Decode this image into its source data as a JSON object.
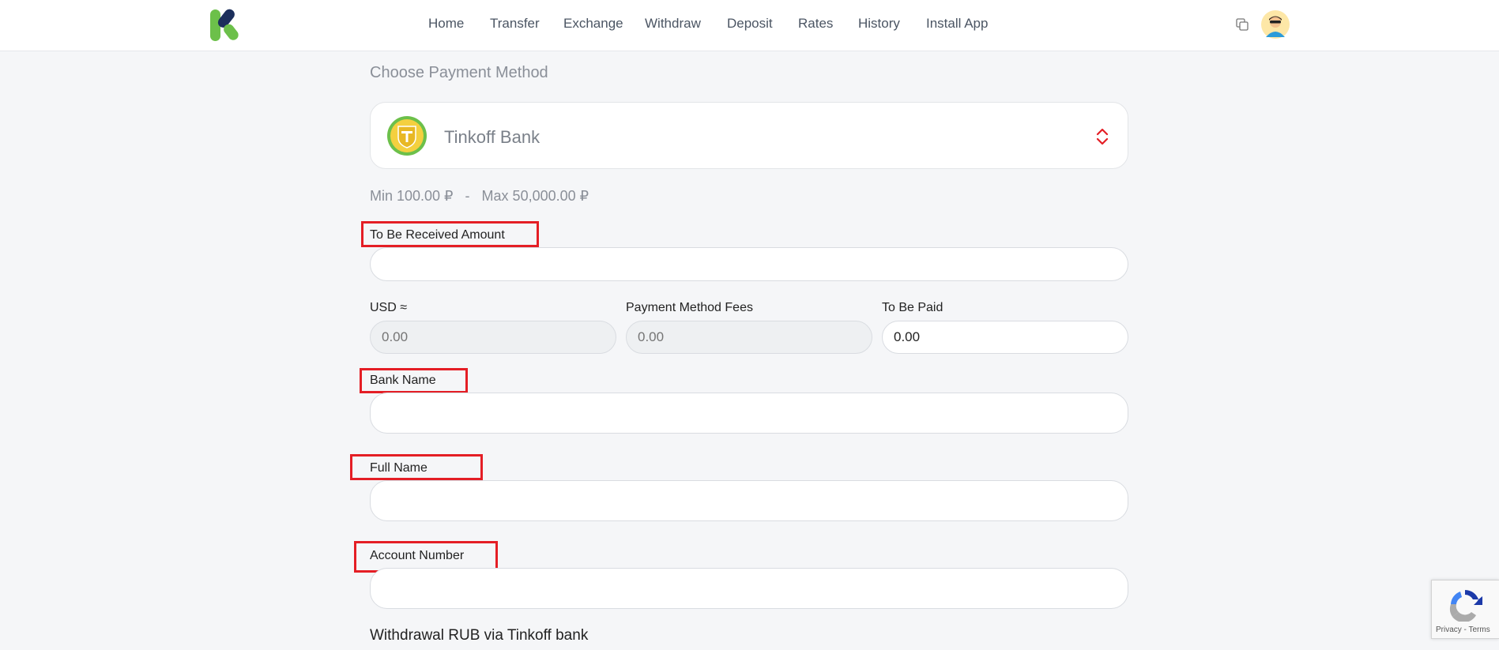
{
  "nav": {
    "items": [
      "Home",
      "Transfer",
      "Exchange",
      "Withdraw",
      "Deposit",
      "Rates",
      "History",
      "Install App"
    ]
  },
  "icons": {
    "logo": "brand-logo",
    "copy": "copy-icon",
    "avatar": "user-avatar",
    "method": "tinkoff-bank-icon",
    "selector": "chevron-up-down-icon",
    "recaptcha": "recaptcha-icon"
  },
  "colors": {
    "highlight": "#e41e25",
    "brand_green": "#6cc04a",
    "brand_navy": "#1c2f5c"
  },
  "main": {
    "title": "Choose Payment Method",
    "payment_method": {
      "name": "Tinkoff Bank"
    },
    "limits": {
      "min": "Min 100.00 ₽",
      "separator": "-",
      "max": "Max 50,000.00 ₽"
    },
    "fields": {
      "received_amount": {
        "label": "To Be Received Amount",
        "value": ""
      },
      "usd": {
        "label": "USD ≈",
        "placeholder": "0.00"
      },
      "fees": {
        "label": "Payment Method Fees",
        "placeholder": "0.00"
      },
      "to_be_paid": {
        "label": "To Be Paid",
        "value": "0.00"
      },
      "bank_name": {
        "label": "Bank Name",
        "value": ""
      },
      "full_name": {
        "label": "Full Name",
        "value": ""
      },
      "account_number": {
        "label": "Account Number",
        "value": ""
      }
    },
    "withdrawal_title": "Withdrawal RUB via Tinkoff bank"
  },
  "recaptcha": {
    "links": "Privacy - Terms"
  }
}
